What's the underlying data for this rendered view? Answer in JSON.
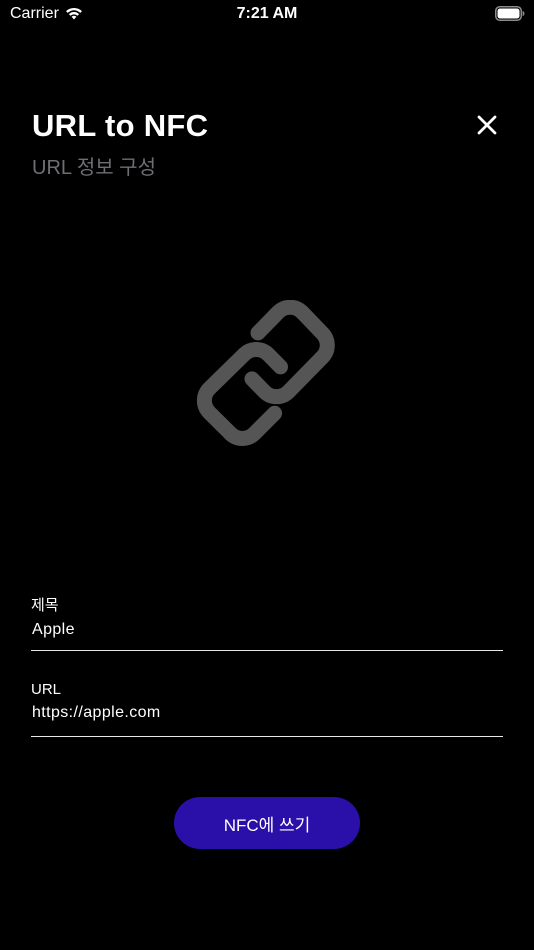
{
  "status_bar": {
    "carrier": "Carrier",
    "time": "7:21 AM",
    "wifi_icon": "wifi-icon",
    "battery_icon": "battery-icon"
  },
  "header": {
    "title": "URL to NFC",
    "subtitle": "URL 정보 구성",
    "close_icon": "close-icon"
  },
  "illustration": {
    "icon": "link-icon",
    "color": "#555555"
  },
  "form": {
    "title_field": {
      "label": "제목",
      "value": "Apple"
    },
    "url_field": {
      "label": "URL",
      "value": "https://apple.com"
    }
  },
  "action": {
    "write_label": "NFC에 쓰기",
    "color": "#2a0fa8"
  }
}
